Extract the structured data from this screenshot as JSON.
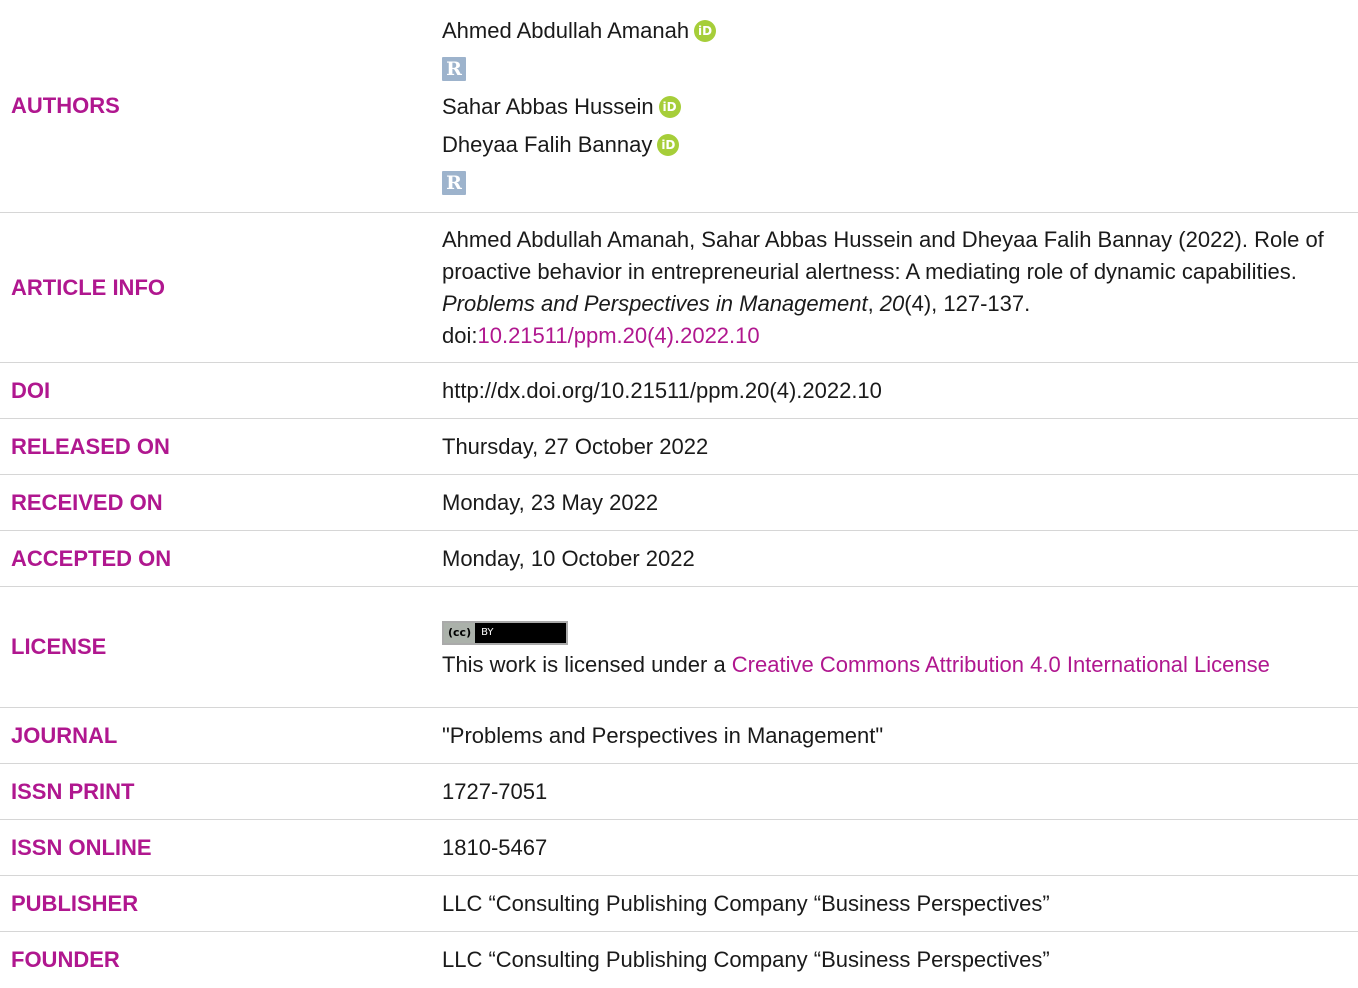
{
  "authors": {
    "label": "AUTHORS",
    "list": [
      {
        "name": "Ahmed Abdullah Amanah",
        "orcid": "iD",
        "researchgate": "R"
      },
      {
        "name": "Sahar Abbas Hussein",
        "orcid": "iD"
      },
      {
        "name": "Dheyaa Falih Bannay",
        "orcid": "iD",
        "researchgate": "R"
      }
    ]
  },
  "article_info": {
    "label": "ARTICLE INFO",
    "citation_pre": "Ahmed Abdullah Amanah, Sahar Abbas Hussein and Dheyaa Falih Bannay (2022). Role of proactive behavior in entrepreneurial alertness: A mediating role of dynamic capabilities. ",
    "journal_italic": "Problems and Perspectives in Management",
    "sep1": ", ",
    "volume_italic": "20",
    "issue_pages": "(4), 127-137. doi:",
    "doi_link": "10.21511/ppm.20(4).2022.10"
  },
  "rows": {
    "doi": {
      "label": "DOI",
      "value": "http://dx.doi.org/10.21511/ppm.20(4).2022.10"
    },
    "released": {
      "label": "RELEASED ON",
      "value": "Thursday, 27 October 2022"
    },
    "received": {
      "label": "RECEIVED ON",
      "value": "Monday, 23 May 2022"
    },
    "accepted": {
      "label": "ACCEPTED ON",
      "value": "Monday, 10 October 2022"
    },
    "journal": {
      "label": "JOURNAL",
      "value": "\"Problems and Perspectives in Management\""
    },
    "issn_print": {
      "label": "ISSN PRINT",
      "value": "1727-7051"
    },
    "issn_online": {
      "label": "ISSN ONLINE",
      "value": "1810-5467"
    },
    "publisher": {
      "label": "PUBLISHER",
      "value": "LLC “Consulting Publishing Company “Business Perspectives”"
    },
    "founder": {
      "label": "FOUNDER",
      "value": "LLC “Consulting Publishing Company “Business Perspectives”"
    }
  },
  "license": {
    "label": "LICENSE",
    "badge_left": "(cc)",
    "badge_right": "BY",
    "text_pre": "This work is licensed under a ",
    "link_text": "Creative Commons Attribution 4.0 International License"
  },
  "colors": {
    "accent": "#b0178f",
    "orcid": "#a6ce39",
    "researchgate": "#9db3cc",
    "divider": "#d6d6d6"
  }
}
